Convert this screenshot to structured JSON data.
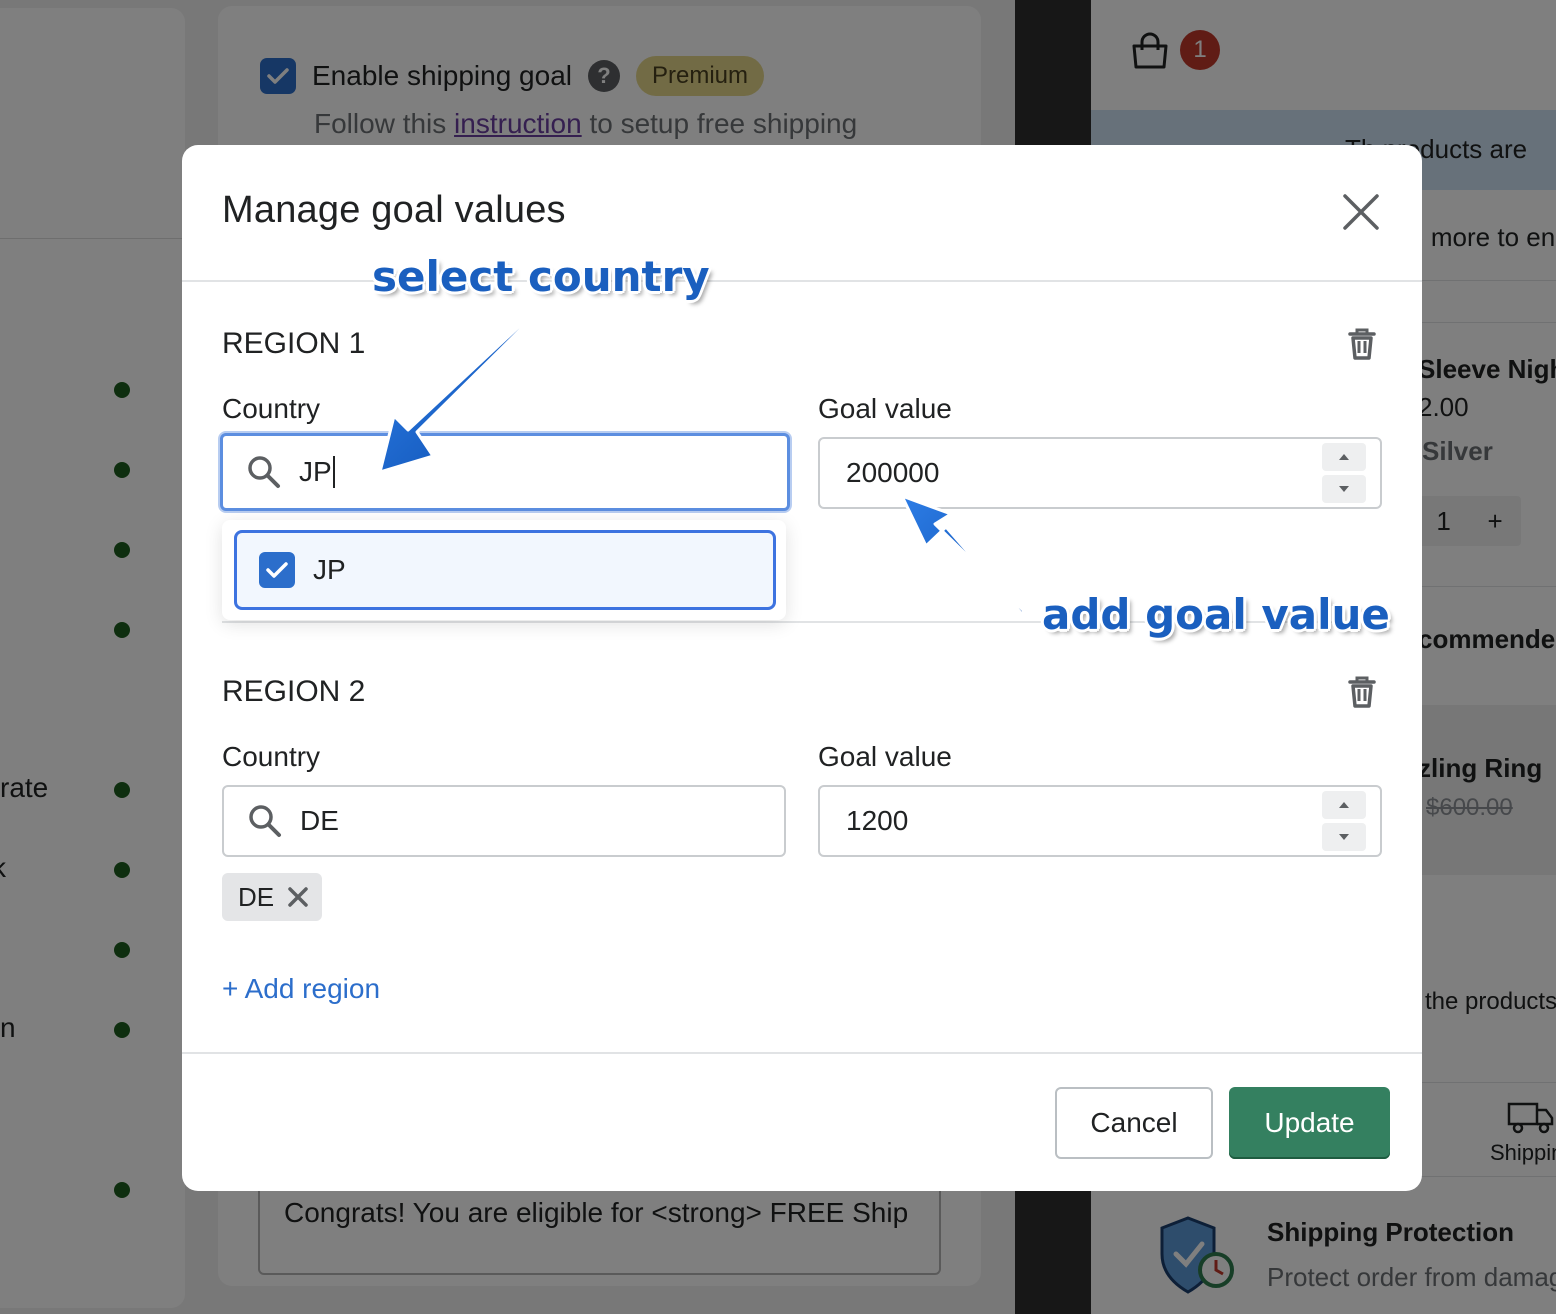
{
  "background": {
    "enable_shipping_goal_label": "Enable shipping goal",
    "help_icon": "?",
    "premium_badge": "Premium",
    "follow_prefix": "Follow this ",
    "follow_link": "instruction",
    "follow_suffix": " to setup free shipping",
    "left_fragments": [
      "rate",
      "k",
      "n"
    ],
    "congrats_text": "Congrats! You are eligible for <strong> FREE Ship",
    "cart_count": "1",
    "promo_text": "Th    products are",
    "more_text": ") more to en",
    "product_title": "Sleeve Nigh",
    "product_price": "2.00",
    "product_variant": "Silver",
    "qty_value": "1",
    "qty_plus": "+",
    "recommended_text": "commended",
    "ring_title": "zling Ring",
    "ring_price": "$600.00",
    "the_products_text": "the products",
    "shipping_label": "Shippin",
    "shipping_protection_title": "Shipping Protection",
    "shipping_protection_desc": "Protect order from damag"
  },
  "modal": {
    "title": "Manage goal values",
    "regions": [
      {
        "title": "REGION 1",
        "country_label": "Country",
        "country_input": "JP",
        "goal_label": "Goal value",
        "goal_value": "200000",
        "dropdown_option": "JP"
      },
      {
        "title": "REGION 2",
        "country_label": "Country",
        "country_input": "DE",
        "goal_label": "Goal value",
        "goal_value": "1200",
        "tag": "DE"
      }
    ],
    "add_region": "+ Add region",
    "cancel": "Cancel",
    "update": "Update"
  },
  "annotations": {
    "select_country": "select country",
    "add_goal_value": "add goal value"
  },
  "colors": {
    "primary": "#348060",
    "accent_blue": "#2c6ecb",
    "annotation_blue": "#1a5fbf"
  }
}
